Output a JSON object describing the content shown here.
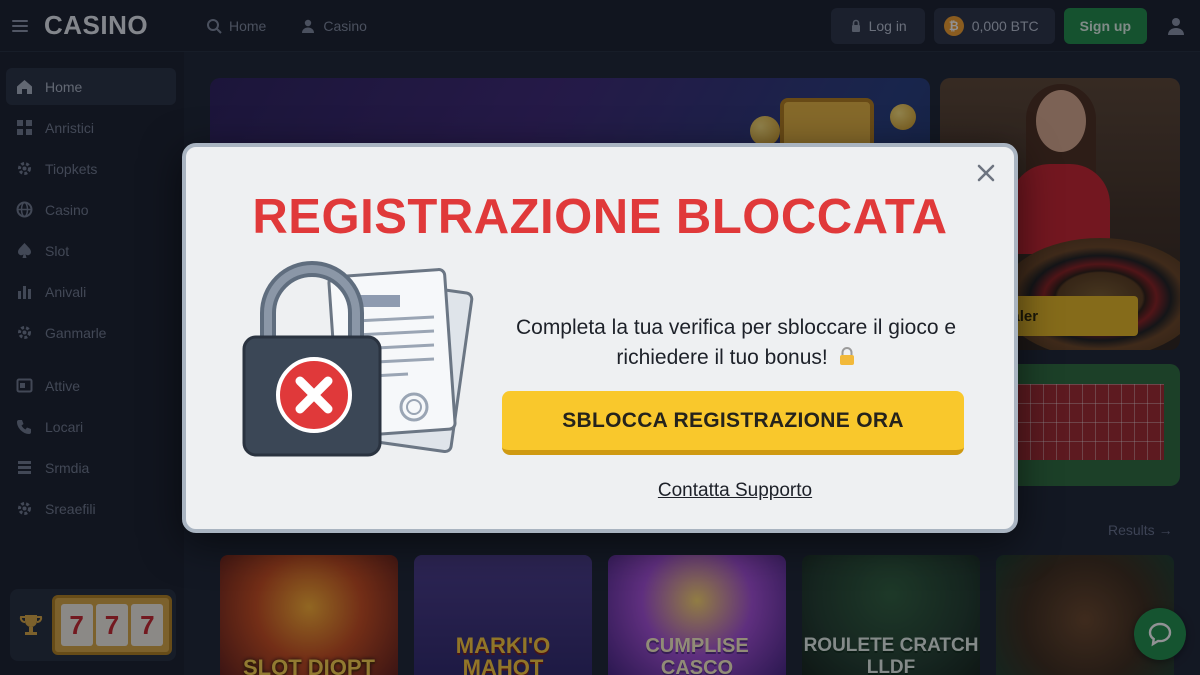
{
  "header": {
    "logo": "CASINO",
    "nav": [
      {
        "label": "Home",
        "icon": "search-icon"
      },
      {
        "label": "Casino",
        "icon": "user-icon"
      }
    ],
    "login_label": "Log in",
    "balance": "0,000 BTC",
    "signup_label": "Sign up"
  },
  "sidebar": {
    "items": [
      {
        "label": "Home",
        "icon": "home-icon",
        "active": true
      },
      {
        "label": "Anristici",
        "icon": "grid-icon"
      },
      {
        "label": "Tiopkets",
        "icon": "gear-icon"
      },
      {
        "label": "Casino",
        "icon": "globe-icon"
      },
      {
        "label": "Slot",
        "icon": "spade-icon"
      },
      {
        "label": "Anivali",
        "icon": "bar-chart-icon"
      },
      {
        "label": "Ganmarle",
        "icon": "gear-icon"
      },
      {
        "label": "Attive",
        "icon": "window-icon"
      },
      {
        "label": "Locari",
        "icon": "phone-icon"
      },
      {
        "label": "Srmdia",
        "icon": "list-icon"
      },
      {
        "label": "Sreaefili",
        "icon": "gear-icon"
      }
    ],
    "promo_reels": [
      "7",
      "7",
      "7"
    ]
  },
  "main": {
    "live_badge": "Live Dealer",
    "results_link": "Results",
    "games": [
      {
        "title": "SLOT DIOPT"
      },
      {
        "title": "MARKI'O MAHOT"
      },
      {
        "title": "CUMPLISE CASCO"
      },
      {
        "title": "ROULETE CRATCH LLDF"
      },
      {
        "title": ""
      }
    ]
  },
  "modal": {
    "title": "REGISTRAZIONE BLOCCATA",
    "message": "Completa la tua verifica per sbloccare il gioco e richiedere il tuo bonus!",
    "cta_label": "SBLOCCA REGISTRAZIONE ORA",
    "support_label": "Contatta Supporto"
  },
  "colors": {
    "modal_title": "#e0393a",
    "cta_background": "#f9c82c",
    "signup_background": "#1e8a45",
    "lock_badge": "#e0393a"
  }
}
